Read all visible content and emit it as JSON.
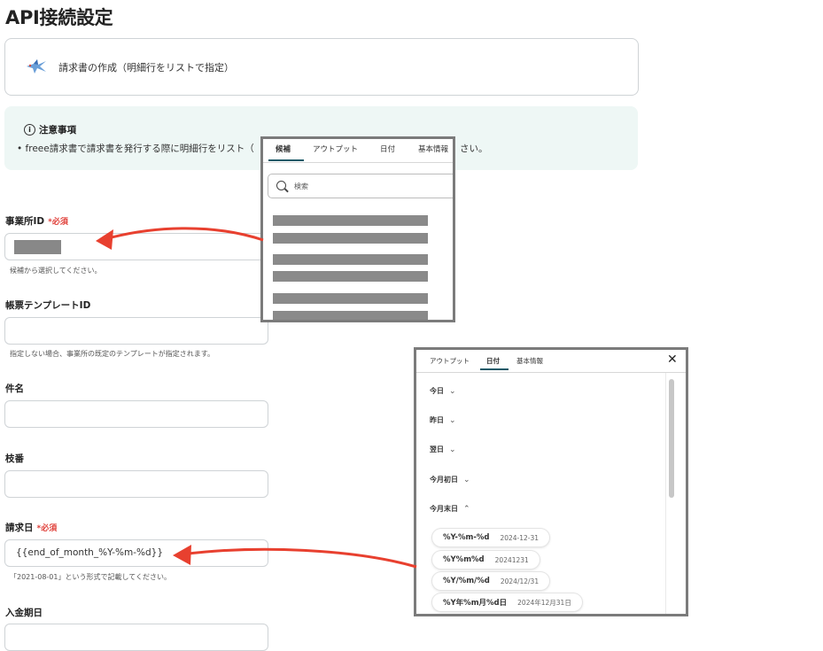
{
  "page": {
    "title": "API接続設定"
  },
  "action": {
    "label": "請求書の作成（明細行をリストで指定）",
    "icon": "bird-icon"
  },
  "notice": {
    "title": "注意事項",
    "body": "freee請求書で請求書を発行する際に明細行をリスト（",
    "tail": "さい。"
  },
  "fields": {
    "office_id": {
      "label": "事業所ID",
      "required": "必須",
      "hint": "候補から選択してください。"
    },
    "template_id": {
      "label": "帳票テンプレートID",
      "hint": "指定しない場合、事業所の既定のテンプレートが指定されます。"
    },
    "subject": {
      "label": "件名"
    },
    "branch_no": {
      "label": "枝番"
    },
    "invoice_date": {
      "label": "請求日",
      "required": "必須",
      "value": "{{end_of_month_%Y-%m-%d}}",
      "hint": "「2021-08-01」という形式で記載してください。"
    },
    "due_date": {
      "label": "入金期日"
    }
  },
  "popup1": {
    "tabs": [
      "候補",
      "アウトプット",
      "日付",
      "基本情報"
    ],
    "active_tab": "候補",
    "search_placeholder": "検索"
  },
  "popup2": {
    "tabs": [
      "アウトプット",
      "日付",
      "基本情報"
    ],
    "active_tab": "日付",
    "close": "✕",
    "items": [
      {
        "label": "今日",
        "chevron": "⌄"
      },
      {
        "label": "昨日",
        "chevron": "⌄"
      },
      {
        "label": "翌日",
        "chevron": "⌄"
      },
      {
        "label": "今月初日",
        "chevron": "⌄"
      },
      {
        "label": "今月末日",
        "chevron": "⌃"
      }
    ],
    "formats": [
      {
        "code": "%Y-%m-%d",
        "sample": "2024-12-31"
      },
      {
        "code": "%Y%m%d",
        "sample": "20241231"
      },
      {
        "code": "%Y/%m/%d",
        "sample": "2024/12/31"
      },
      {
        "code": "%Y年%m月%d日",
        "sample": "2024年12月31日"
      }
    ]
  },
  "colors": {
    "arrow": "#e8402f",
    "tab_underline": "#1a5a68",
    "required": "#e0403a",
    "notice_bg": "#eef7f5"
  }
}
